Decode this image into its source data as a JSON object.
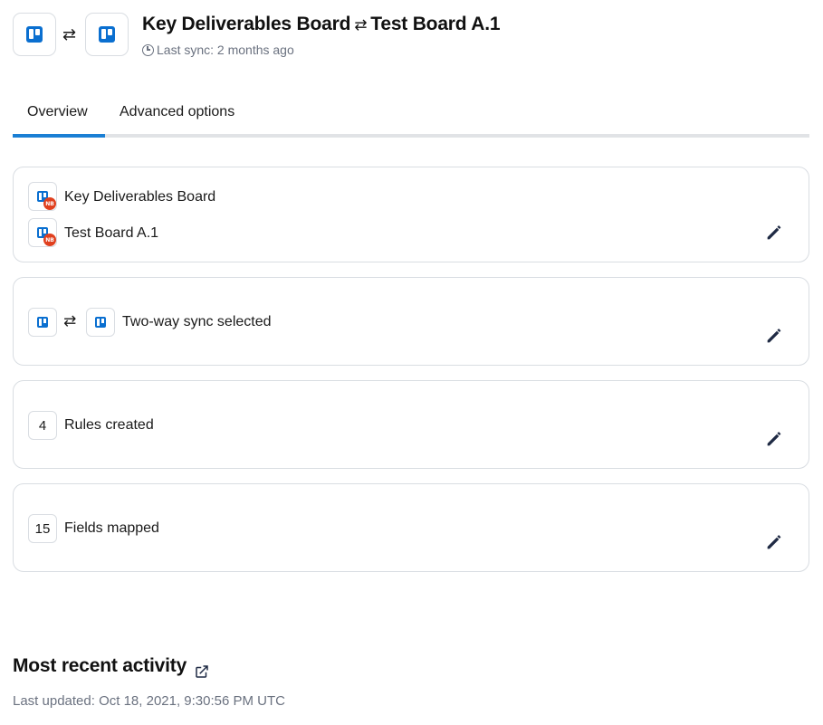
{
  "header": {
    "source_app_icon": "trello-icon",
    "target_app_icon": "trello-icon",
    "swap_glyph": "⇄",
    "title_source": "Key Deliverables Board",
    "title_separator": "⇄",
    "title_target": "Test Board A.1",
    "sync_status": "Last sync: 2 months ago"
  },
  "tabs": [
    {
      "label": "Overview",
      "active": true
    },
    {
      "label": "Advanced options",
      "active": false
    }
  ],
  "cards": {
    "boards": {
      "source_label": "Key Deliverables Board",
      "target_label": "Test Board A.1",
      "badge_text": "NB"
    },
    "sync_direction": {
      "swap_glyph": "⇄",
      "label": "Two-way sync selected"
    },
    "rules": {
      "count": "4",
      "label": "Rules created"
    },
    "fields": {
      "count": "15",
      "label": "Fields mapped"
    }
  },
  "activity": {
    "title": "Most recent activity",
    "last_updated": "Last updated: Oct 18, 2021, 9:30:56 PM UTC"
  },
  "colors": {
    "accent": "#1a7fd4",
    "trello_blue": "#0a6fd0",
    "badge_red": "#e0401f",
    "muted_text": "#6b7280",
    "edit_icon": "#1f2a44"
  }
}
